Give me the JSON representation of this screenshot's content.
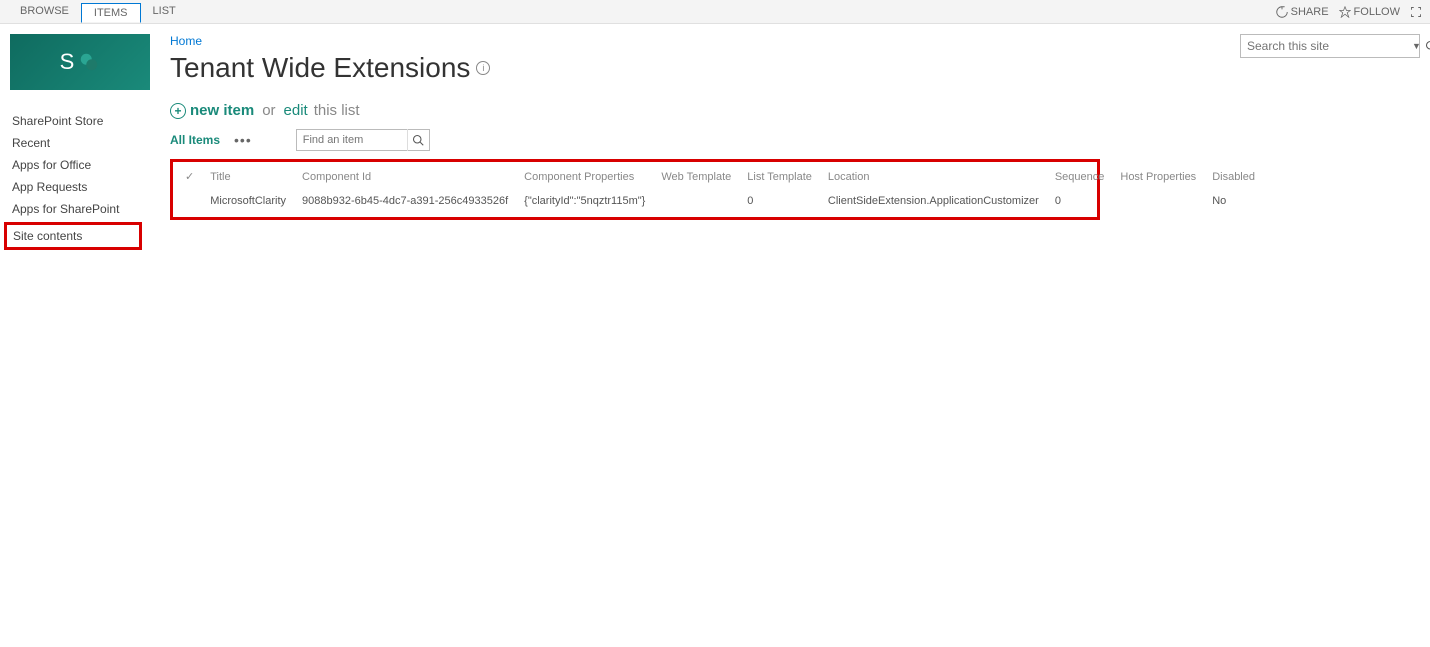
{
  "ribbon": {
    "tabs": [
      "BROWSE",
      "ITEMS",
      "LIST"
    ],
    "active_tab_index": 1,
    "share_label": "SHARE",
    "follow_label": "FOLLOW"
  },
  "logo_letter": "S",
  "sidebar": {
    "items": [
      "SharePoint Store",
      "Recent",
      "Apps for Office",
      "App Requests",
      "Apps for SharePoint"
    ],
    "highlighted_item": "Site contents"
  },
  "breadcrumb": "Home",
  "page_title": "Tenant Wide Extensions",
  "list_actions": {
    "new_item": "new item",
    "or": "or",
    "edit": "edit",
    "this_list": "this list"
  },
  "view": {
    "name": "All Items",
    "find_placeholder": "Find an item"
  },
  "table": {
    "headers": [
      "Title",
      "Component Id",
      "Component Properties",
      "Web Template",
      "List Template",
      "Location",
      "Sequence",
      "Host Properties",
      "Disabled"
    ],
    "row": {
      "title": "MicrosoftClarity",
      "component_id": "9088b932-6b45-4dc7-a391-256c4933526f",
      "component_properties": "{\"clarityId\":\"5nqztr115m\"}",
      "web_template": "",
      "list_template": "0",
      "location": "ClientSideExtension.ApplicationCustomizer",
      "sequence": "0",
      "host_properties": "",
      "disabled": "No"
    }
  },
  "search_placeholder": "Search this site"
}
